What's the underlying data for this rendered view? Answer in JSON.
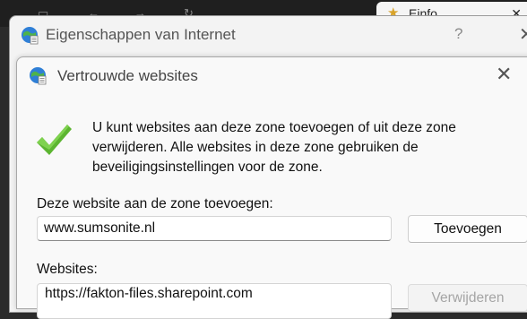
{
  "background_browser": {
    "tab_title": "Einfo..."
  },
  "outer_dialog": {
    "title": "Eigenschappen van Internet",
    "help_glyph": "?",
    "close_glyph": "✕"
  },
  "inner_dialog": {
    "title": "Vertrouwde websites",
    "close_glyph": "✕",
    "description": "U kunt websites aan deze zone toevoegen of uit deze zone verwijderen. Alle websites in deze zone gebruiken de beveiligingsinstellingen voor de zone.",
    "add_label": "Deze website aan de zone toevoegen:",
    "add_input_value": "www.sumsonite.nl",
    "add_button": "Toevoegen",
    "websites_label": "Websites:",
    "websites": [
      "https://fakton-files.sharepoint.com"
    ],
    "remove_button": "Verwijderen"
  },
  "icons": {
    "dialog_icon": "internet-options-globe-icon",
    "status_icon": "green-checkmark-icon"
  },
  "colors": {
    "checkmark": "#5cb531",
    "globe": "#2f7fd6"
  }
}
